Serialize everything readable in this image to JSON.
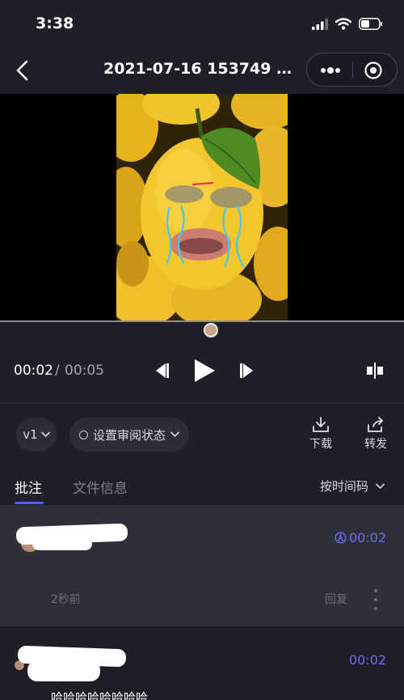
{
  "status_bar": {
    "time": "3:38",
    "icons": [
      "signal-icon",
      "wifi-icon",
      "battery-icon"
    ]
  },
  "header": {
    "title": "2021-07-16 153749 1...",
    "icons": [
      "back-chevron-icon",
      "more-dots-icon",
      "target-icon"
    ]
  },
  "player": {
    "current_time": "00:02",
    "separator": "/",
    "total_time": "00:05",
    "progress_fraction": 0.4,
    "controls": [
      "prev-frame-icon",
      "play-icon",
      "next-frame-icon",
      "split-view-icon"
    ]
  },
  "actions": {
    "version": "v1",
    "review_status": "设置审阅状态",
    "download": "下载",
    "forward": "转发"
  },
  "tabs": {
    "annotations": "批注",
    "file_info": "文件信息",
    "sort": "按时间码"
  },
  "comments": [
    {
      "timecode": "00:02",
      "time_ago": "2秒前",
      "reply": "回复",
      "text": ""
    },
    {
      "timecode": "00:02",
      "text": "哈哈哈哈哈哈哈哈"
    }
  ],
  "colors": {
    "accent": "#5a5bf2",
    "timecode": "#6e6cf2",
    "background": "#1e1f27",
    "active_comment_bg": "#2e2f38"
  }
}
